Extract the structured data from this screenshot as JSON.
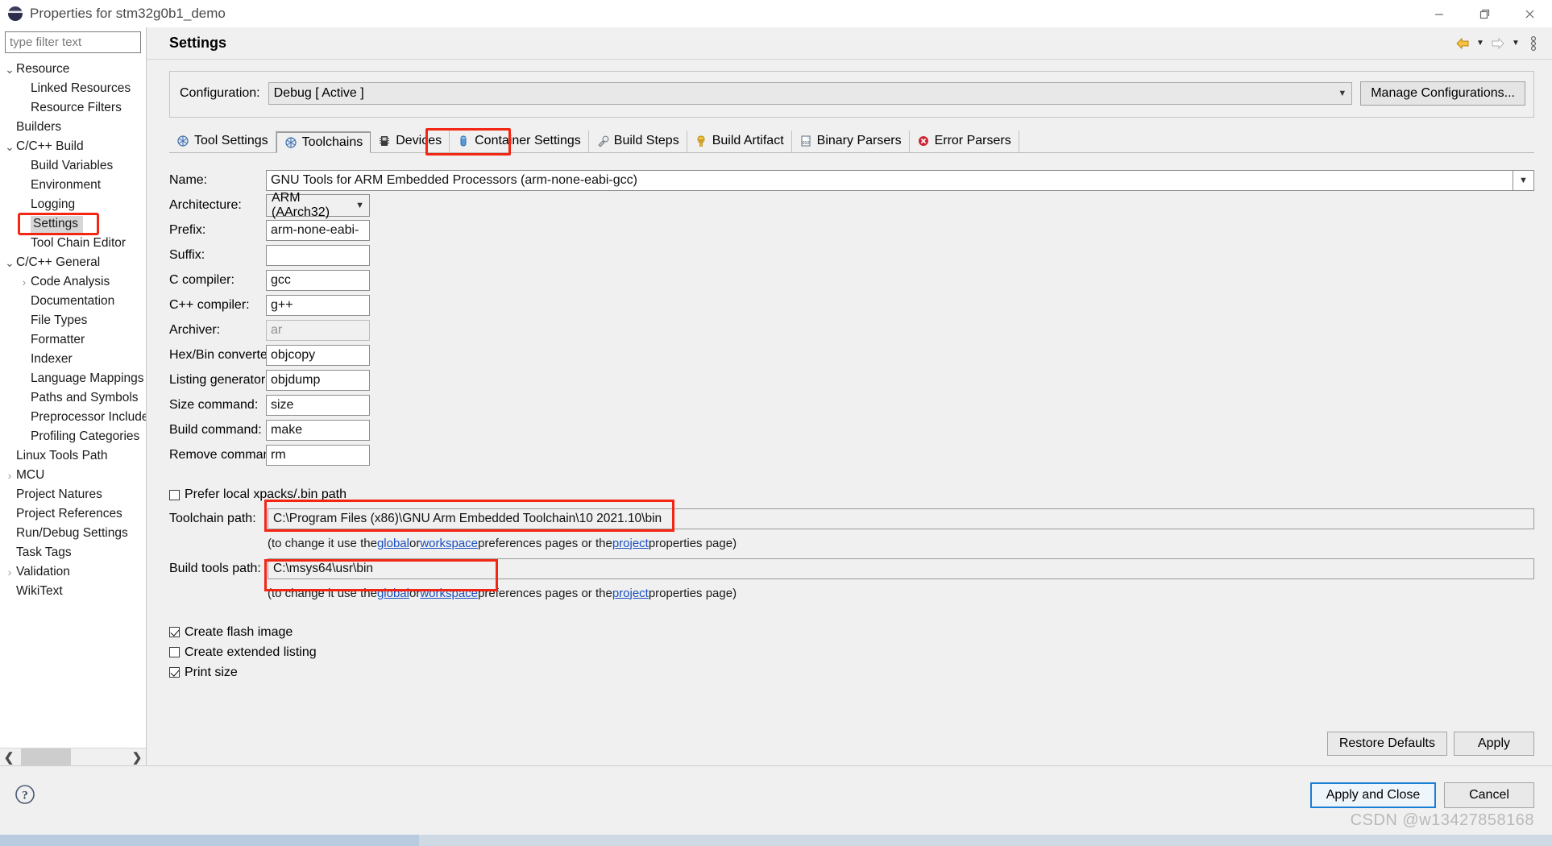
{
  "window": {
    "title": "Properties for stm32g0b1_demo",
    "icon": "eclipse-logo-icon",
    "minimize": "—",
    "maximize": "❐",
    "close": "✕"
  },
  "filter": {
    "placeholder": "type filter text",
    "value": ""
  },
  "tree": {
    "selected": "Settings",
    "items": [
      {
        "label": "Resource",
        "indent": 0,
        "twisty": "expanded"
      },
      {
        "label": "Linked Resources",
        "indent": 1,
        "twisty": "none"
      },
      {
        "label": "Resource Filters",
        "indent": 1,
        "twisty": "none"
      },
      {
        "label": "Builders",
        "indent": 0,
        "twisty": "none"
      },
      {
        "label": "C/C++ Build",
        "indent": 0,
        "twisty": "expanded"
      },
      {
        "label": "Build Variables",
        "indent": 1,
        "twisty": "none"
      },
      {
        "label": "Environment",
        "indent": 1,
        "twisty": "none"
      },
      {
        "label": "Logging",
        "indent": 1,
        "twisty": "none"
      },
      {
        "label": "Settings",
        "indent": 1,
        "twisty": "none"
      },
      {
        "label": "Tool Chain Editor",
        "indent": 1,
        "twisty": "none"
      },
      {
        "label": "C/C++ General",
        "indent": 0,
        "twisty": "expanded"
      },
      {
        "label": "Code Analysis",
        "indent": 1,
        "twisty": "collapsed"
      },
      {
        "label": "Documentation",
        "indent": 1,
        "twisty": "none"
      },
      {
        "label": "File Types",
        "indent": 1,
        "twisty": "none"
      },
      {
        "label": "Formatter",
        "indent": 1,
        "twisty": "none"
      },
      {
        "label": "Indexer",
        "indent": 1,
        "twisty": "none"
      },
      {
        "label": "Language Mappings",
        "indent": 1,
        "twisty": "none"
      },
      {
        "label": "Paths and Symbols",
        "indent": 1,
        "twisty": "none"
      },
      {
        "label": "Preprocessor Include",
        "indent": 1,
        "twisty": "none"
      },
      {
        "label": "Profiling Categories",
        "indent": 1,
        "twisty": "none"
      },
      {
        "label": "Linux Tools Path",
        "indent": 0,
        "twisty": "none"
      },
      {
        "label": "MCU",
        "indent": 0,
        "twisty": "collapsed"
      },
      {
        "label": "Project Natures",
        "indent": 0,
        "twisty": "none"
      },
      {
        "label": "Project References",
        "indent": 0,
        "twisty": "none"
      },
      {
        "label": "Run/Debug Settings",
        "indent": 0,
        "twisty": "none"
      },
      {
        "label": "Task Tags",
        "indent": 0,
        "twisty": "none"
      },
      {
        "label": "Validation",
        "indent": 0,
        "twisty": "collapsed"
      },
      {
        "label": "WikiText",
        "indent": 0,
        "twisty": "none"
      }
    ]
  },
  "page": {
    "title": "Settings",
    "nav_back": "back-arrow-icon",
    "nav_forward": "forward-arrow-icon",
    "menu": "view-menu-icon"
  },
  "configuration": {
    "label": "Configuration:",
    "value": "Debug  [ Active ]",
    "manage_button": "Manage Configurations..."
  },
  "tabs": [
    {
      "label": "Tool Settings",
      "icon": "tool-settings-icon",
      "active": false
    },
    {
      "label": "Toolchains",
      "icon": "toolchains-icon",
      "active": true
    },
    {
      "label": "Devices",
      "icon": "device-chip-icon",
      "active": false
    },
    {
      "label": "Container Settings",
      "icon": "container-icon",
      "active": false
    },
    {
      "label": "Build Steps",
      "icon": "build-steps-icon",
      "active": false
    },
    {
      "label": "Build Artifact",
      "icon": "build-artifact-icon",
      "active": false
    },
    {
      "label": "Binary Parsers",
      "icon": "binary-parsers-icon",
      "active": false
    },
    {
      "label": "Error Parsers",
      "icon": "error-parsers-icon",
      "active": false
    }
  ],
  "form": {
    "name": {
      "label": "Name:",
      "value": "GNU Tools for ARM Embedded Processors (arm-none-eabi-gcc)"
    },
    "architecture": {
      "label": "Architecture:",
      "value": "ARM (AArch32)"
    },
    "prefix": {
      "label": "Prefix:",
      "value": "arm-none-eabi-"
    },
    "suffix": {
      "label": "Suffix:",
      "value": ""
    },
    "c_compiler": {
      "label": "C compiler:",
      "value": "gcc"
    },
    "cpp_compiler": {
      "label": "C++ compiler:",
      "value": "g++"
    },
    "archiver": {
      "label": "Archiver:",
      "value": "ar"
    },
    "hexbin": {
      "label": "Hex/Bin converter:",
      "value": "objcopy"
    },
    "listing": {
      "label": "Listing generator:",
      "value": "objdump"
    },
    "size": {
      "label": "Size command:",
      "value": "size"
    },
    "build": {
      "label": "Build command:",
      "value": "make"
    },
    "remove": {
      "label": "Remove command:",
      "value": "rm"
    }
  },
  "paths": {
    "prefer_local": {
      "label": "Prefer local xpacks/.bin path",
      "checked": false
    },
    "toolchain": {
      "label": "Toolchain path:",
      "value": "C:\\Program Files (x86)\\GNU Arm Embedded Toolchain\\10 2021.10\\bin"
    },
    "build_tools": {
      "label": "Build tools path:",
      "value": "C:\\msys64\\usr\\bin"
    },
    "hint": {
      "prefix": "(to change it use the ",
      "link1": "global",
      "mid1": " or ",
      "link2": "workspace",
      "mid2": " preferences pages or the ",
      "link3": "project",
      "suffix": " properties page)"
    }
  },
  "options": [
    {
      "label": "Create flash image",
      "checked": true
    },
    {
      "label": "Create extended listing",
      "checked": false
    },
    {
      "label": "Print size",
      "checked": true
    }
  ],
  "page_buttons": {
    "restore": "Restore Defaults",
    "apply": "Apply"
  },
  "dialog_buttons": {
    "help": "help-icon",
    "apply_close": "Apply and Close",
    "cancel": "Cancel"
  },
  "watermark": "CSDN @w13427858168",
  "colors": {
    "highlight_red": "#f22613",
    "link_blue": "#1a4fbf",
    "primary_border": "#1a7fd4",
    "panel_bg": "#f0f0f0"
  }
}
